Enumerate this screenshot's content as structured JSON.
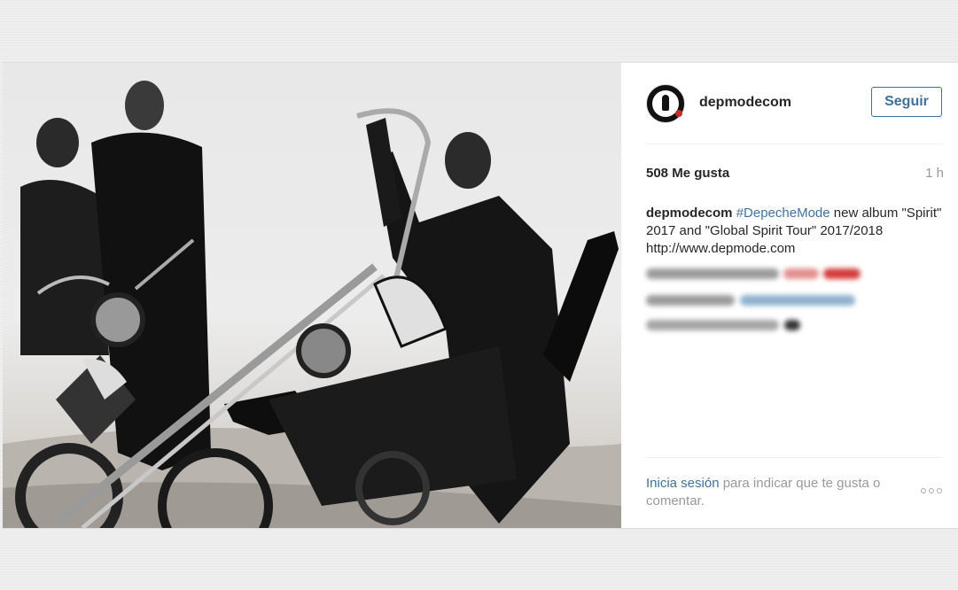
{
  "header": {
    "username": "depmodecom",
    "follow_label": "Seguir"
  },
  "stats": {
    "likes": "508 Me gusta",
    "time_ago": "1 h"
  },
  "caption": {
    "user": "depmodecom",
    "hashtag": "#DepecheMode",
    "text": " new album \"Spirit\" 2017 and \"Global Spirit Tour\" 2017/2018 http://www.depmode.com"
  },
  "footer": {
    "login_link": "Inicia sesión",
    "prompt": " para indicar que te gusta o comentar."
  },
  "icons": {
    "avatar": "depeche-mode-logo",
    "more": "more-options-icon"
  },
  "colors": {
    "link": "#3f729b",
    "text": "#262626",
    "muted": "#999999"
  }
}
